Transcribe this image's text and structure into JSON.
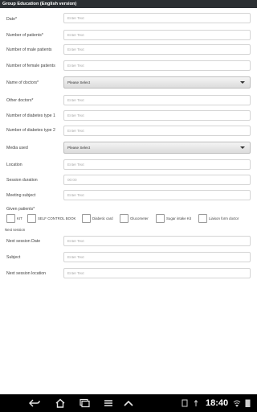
{
  "title": "Group Education (English version)",
  "placeholder": "Enter Text",
  "select_placeholder": "Please Select",
  "fields": {
    "date": "Date*",
    "num_patients": "Number of patients*",
    "num_male": "Number of male patients",
    "num_female": "Number of female patients",
    "name_doctors": "Name of doctors*",
    "other_doctors": "Other doctors*",
    "num_type1": "Number of diabetes type 1",
    "num_type2": "Number of diabetes type 2",
    "media_used": "Media used",
    "location": "Location",
    "session_duration": "Session duration",
    "duration_placeholder": "00:00",
    "meeting_subject": "Meeting subject",
    "given_patients": "Given patients*",
    "next_session_small": "Next session",
    "next_session_date": "Next session Date",
    "subject": "Subject",
    "next_session_location": "Next session location"
  },
  "given_items": [
    "KIT",
    "SELF CONTROL BOOK",
    "Diabetic card",
    "Glucometer",
    "Sugar intake Kit",
    "Liaison form doctor"
  ],
  "status_bar": {
    "clock": "18:40",
    "icons": [
      "back-icon",
      "home-icon",
      "recent-apps-icon",
      "screenshot-icon",
      "menu-icon",
      "up-icon"
    ]
  }
}
